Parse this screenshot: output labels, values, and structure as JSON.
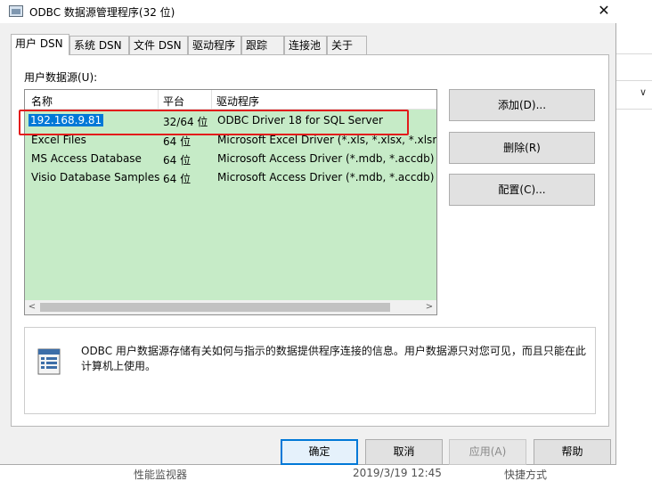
{
  "window": {
    "title": "ODBC 数据源管理程序(32 位)",
    "close_glyph": "✕"
  },
  "tabs": [
    {
      "label": "用户 DSN",
      "active": true
    },
    {
      "label": "系统 DSN"
    },
    {
      "label": "文件 DSN"
    },
    {
      "label": "驱动程序"
    },
    {
      "label": "跟踪"
    },
    {
      "label": "连接池"
    },
    {
      "label": "关于"
    }
  ],
  "group_label": "用户数据源(U):",
  "list": {
    "headers": [
      "名称",
      "平台",
      "驱动程序"
    ],
    "rows": [
      {
        "name": "192.168.9.81",
        "platform": "32/64 位",
        "driver": "ODBC Driver 18 for SQL Server",
        "selected": true
      },
      {
        "name": "Excel Files",
        "platform": "64 位",
        "driver": "Microsoft Excel Driver (*.xls, *.xlsx, *.xlsm, *"
      },
      {
        "name": "MS Access Database",
        "platform": "64 位",
        "driver": "Microsoft Access Driver (*.mdb, *.accdb)"
      },
      {
        "name": "Visio Database Samples",
        "platform": "64 位",
        "driver": "Microsoft Access Driver (*.mdb, *.accdb)"
      }
    ],
    "scroll_left": "<",
    "scroll_right": ">"
  },
  "buttons": {
    "add": "添加(D)...",
    "remove": "删除(R)",
    "configure": "配置(C)..."
  },
  "info_text": "ODBC 用户数据源存储有关如何与指示的数据提供程序连接的信息。用户数据源只对您可见，而且只能在此计算机上使用。",
  "footer": {
    "ok": "确定",
    "cancel": "取消",
    "apply": "应用(A)",
    "help": "帮助"
  },
  "background": {
    "chevron": "∨",
    "bottom_items": [
      "性能监视器",
      "2019/3/19 12:45",
      "快捷方式"
    ]
  },
  "colors": {
    "list_bg": "#c6ebc7",
    "selection": "#0078d7",
    "highlight_box": "#e31b1b"
  }
}
